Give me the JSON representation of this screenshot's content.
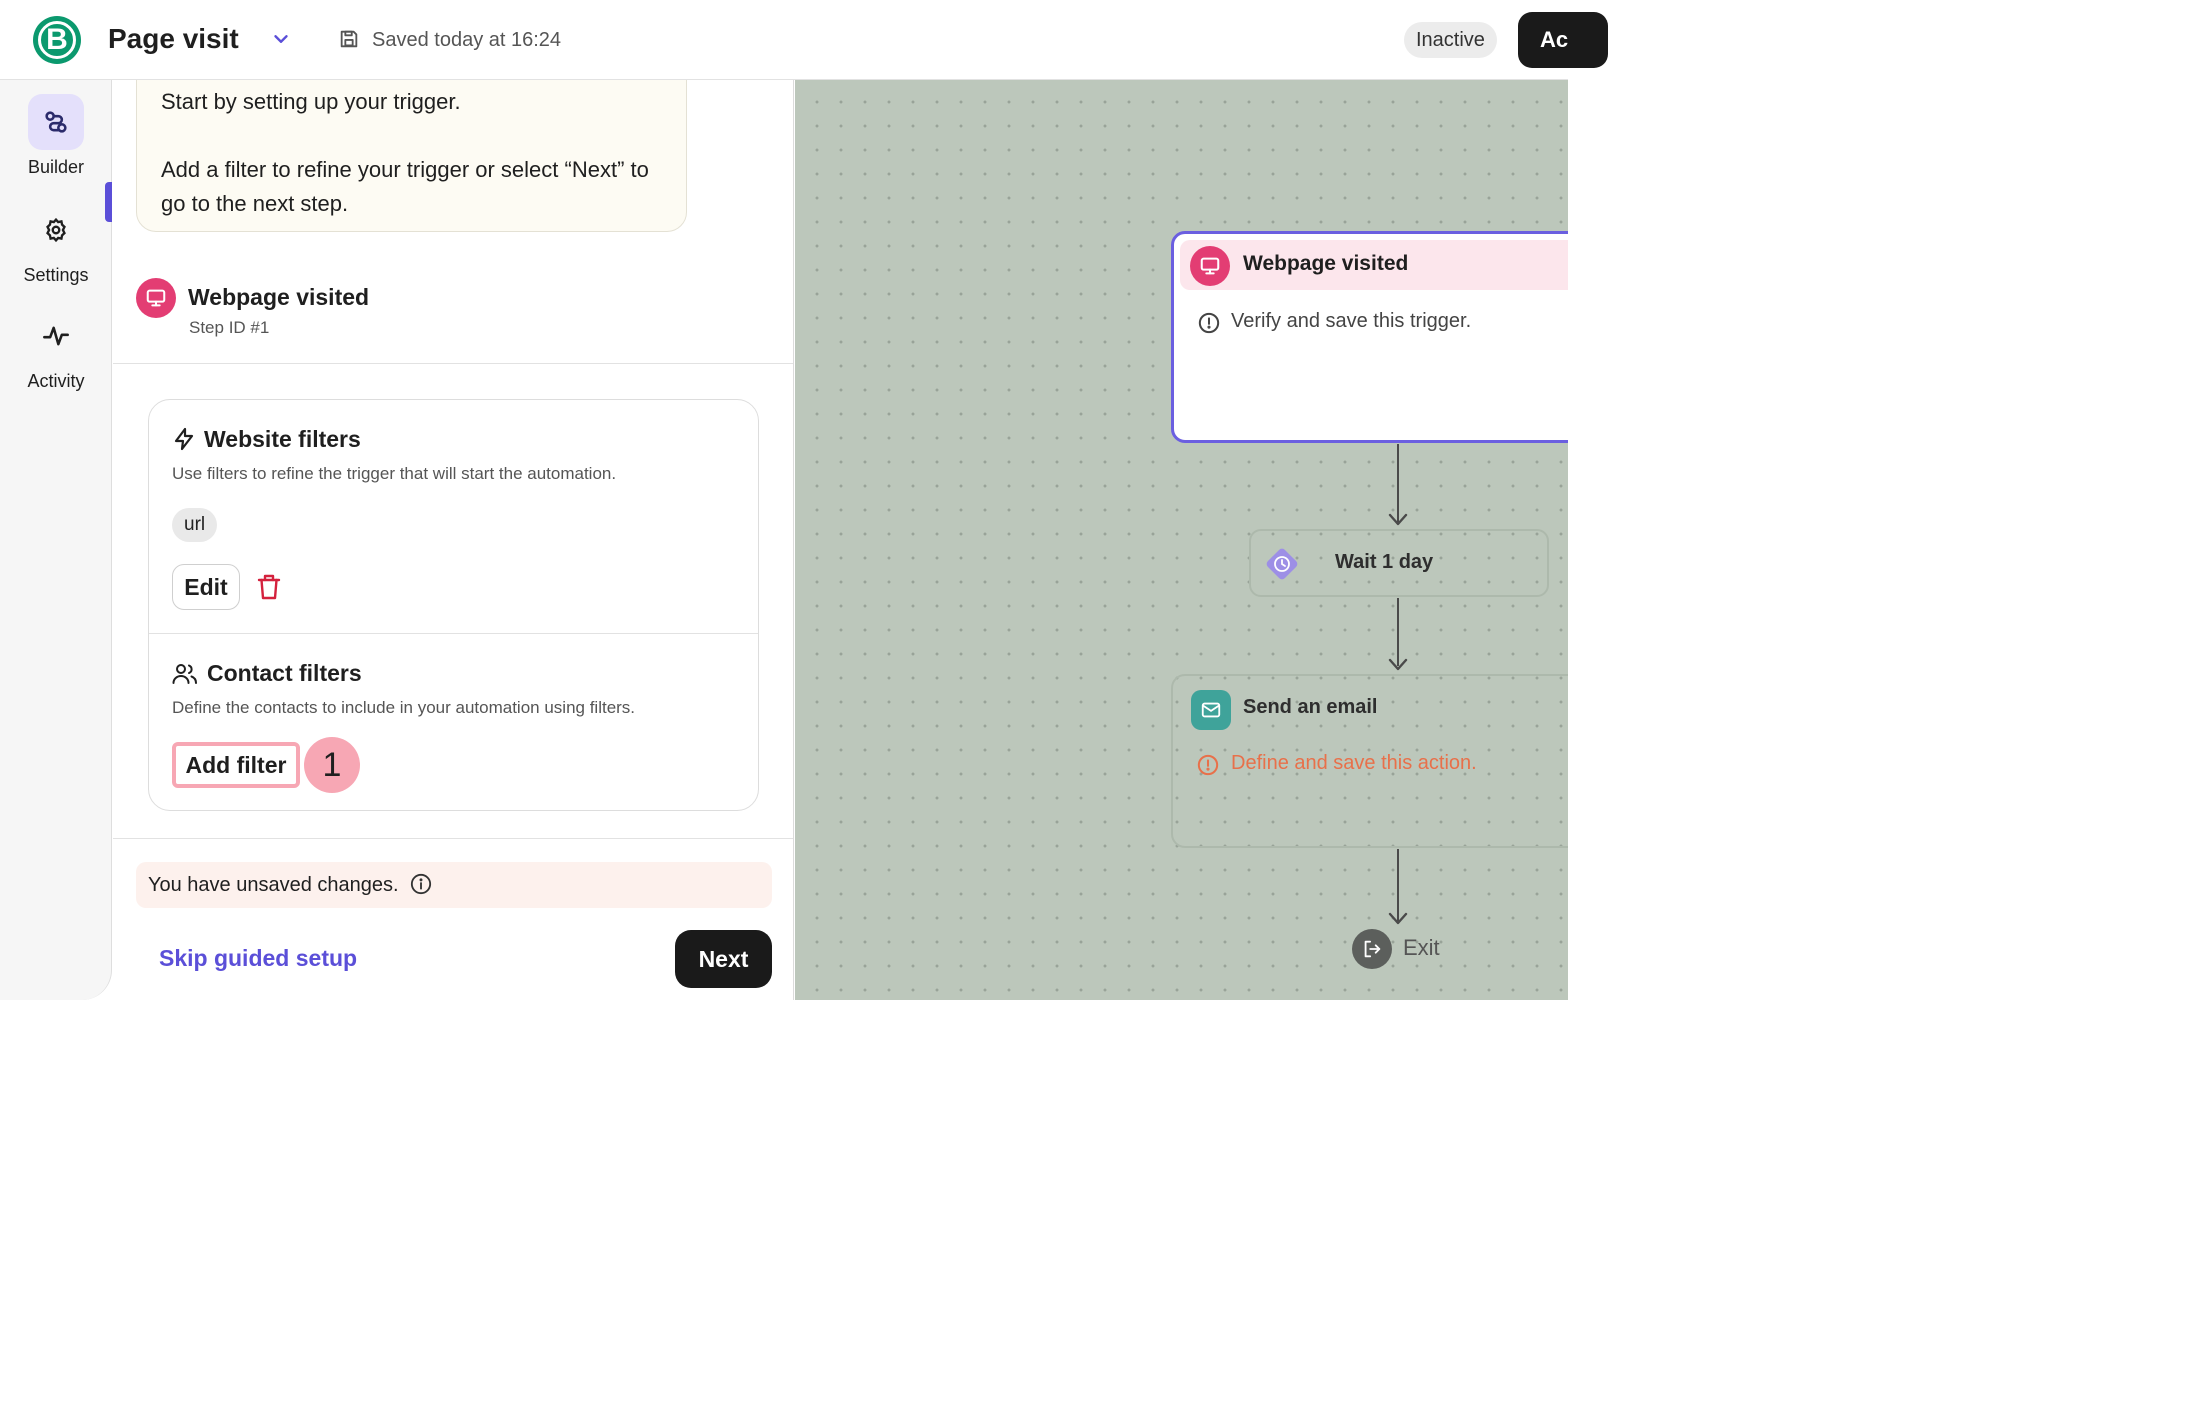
{
  "header": {
    "app_logo_letter": "B",
    "title": "Page visit",
    "saved_status": "Saved today at 16:24",
    "status_badge": "Inactive",
    "activate_label": "Ac"
  },
  "rail": {
    "items": [
      {
        "label": "Builder",
        "icon": "builder-icon",
        "active": true
      },
      {
        "label": "Settings",
        "icon": "gear-icon",
        "active": false
      },
      {
        "label": "Activity",
        "icon": "pulse-icon",
        "active": false
      }
    ]
  },
  "panel": {
    "tip_line1": "Start by setting up your trigger.",
    "tip_line2": "Add a filter to refine your trigger or select “Next” to go to the next step.",
    "step": {
      "title": "Webpage visited",
      "id_label": "Step ID #1",
      "icon": "monitor-icon"
    },
    "website_filters": {
      "title": "Website filters",
      "description": "Use filters to refine the trigger that will start the automation.",
      "chip": "url",
      "edit_label": "Edit"
    },
    "contact_filters": {
      "title": "Contact filters",
      "description": "Define the contacts to include in your automation using filters.",
      "add_filter_label": "Add filter",
      "step_marker": "1"
    },
    "unsaved_notice": "You have unsaved changes.",
    "skip_label": "Skip guided setup",
    "next_label": "Next"
  },
  "canvas": {
    "trigger_node": {
      "title": "Webpage visited",
      "message": "Verify and save this trigger."
    },
    "wait_node": {
      "label": "Wait 1 day"
    },
    "email_node": {
      "title": "Send an email",
      "message": "Define and save this action."
    },
    "exit_label": "Exit"
  },
  "colors": {
    "brand_green": "#0b996e",
    "accent_purple": "#5b4fd8",
    "trigger_pink": "#e33d73",
    "highlight_pink": "#f7a7b4",
    "email_teal": "#3fa39a",
    "warning_orange": "#e8704a",
    "canvas_bg": "#bcc7bb"
  }
}
